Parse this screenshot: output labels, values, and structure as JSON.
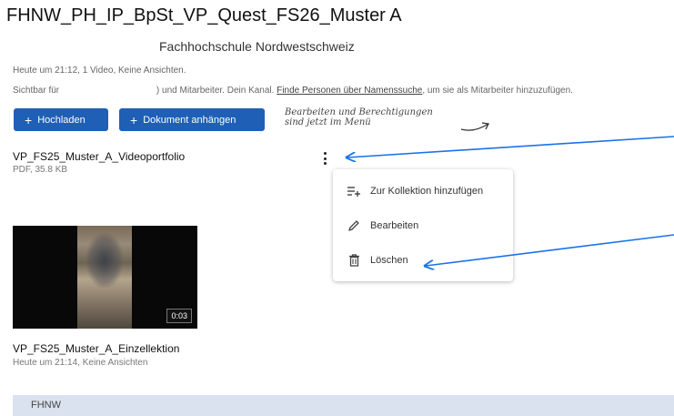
{
  "page": {
    "title": "FHNW_PH_IP_BpSt_VP_Quest_FS26_Muster A",
    "organization": "Fachhochschule Nordwestschweiz",
    "meta_line1": "Heute um 21:12, 1 Video, Keine Ansichten.",
    "visible_prefix": "Sichtbar für",
    "visible_suffix": ") und Mitarbeiter. Dein Kanal. ",
    "find_people_link": "Finde Personen über Namenssuche",
    "visible_end": ", um sie als Mitarbeiter hinzuzufügen."
  },
  "toolbar": {
    "upload_label": "Hochladen",
    "attach_label": "Dokument anhängen",
    "plus": "+"
  },
  "hint": {
    "line1": "Bearbeiten und Berechtigungen",
    "line2": "sind jetzt im Menü"
  },
  "document": {
    "title": "VP_FS25_Muster_A_Videoportfolio",
    "meta": "PDF, 35.8 KB"
  },
  "menu": {
    "items": [
      {
        "label": "Zur Kollektion hinzufügen",
        "icon": "add-to-collection-icon"
      },
      {
        "label": "Bearbeiten",
        "icon": "pencil-icon"
      },
      {
        "label": "Löschen",
        "icon": "trash-icon"
      }
    ]
  },
  "video": {
    "title": "VP_FS25_Muster_A_Einzellektion",
    "meta": "Heute um 21:14, Keine Ansichten",
    "duration": "0:03"
  },
  "footer": {
    "label": "FHNW"
  },
  "colors": {
    "primary_button": "#1f5fb5",
    "annotation_arrow": "#1a73e8",
    "footer_bg": "#d9e2ee"
  }
}
